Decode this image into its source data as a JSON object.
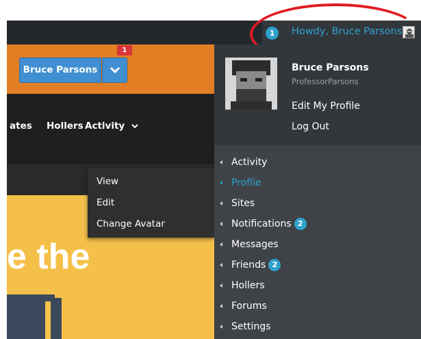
{
  "admin_bar": {
    "notifications_count": "1",
    "greeting": "Howdy, Bruce Parsons"
  },
  "site_header": {
    "user_button_label": "Bruce Parsons",
    "notification_badge": "1"
  },
  "site_nav": {
    "items": [
      {
        "label": "ates"
      },
      {
        "label": "Hollers"
      },
      {
        "label": "Activity"
      }
    ]
  },
  "activity_submenu": {
    "items": [
      {
        "label": "View"
      },
      {
        "label": "Edit"
      },
      {
        "label": "Change Avatar"
      }
    ]
  },
  "hero": {
    "text": "e the"
  },
  "account_menu": {
    "display_name": "Bruce Parsons",
    "username": "ProfessorParsons",
    "edit_profile_label": "Edit My Profile",
    "logout_label": "Log Out"
  },
  "buddypress_menu": {
    "items": [
      {
        "label": "Activity"
      },
      {
        "label": "Profile"
      },
      {
        "label": "Sites"
      },
      {
        "label": "Notifications",
        "count": "2"
      },
      {
        "label": "Messages"
      },
      {
        "label": "Friends",
        "count": "2"
      },
      {
        "label": "Hollers"
      },
      {
        "label": "Forums"
      },
      {
        "label": "Settings"
      }
    ],
    "active_item": "Profile"
  },
  "colors": {
    "admin_bar": "#23282d",
    "accent_blue": "#2ea2cc",
    "orange": "#e27f24",
    "button_blue": "#3f8fd2",
    "highlight_red": "#e01b24",
    "hero_yellow": "#f5c04a"
  },
  "icons": [
    "chevron-down-icon",
    "avatar-icon",
    "arrow-left-icon"
  ]
}
